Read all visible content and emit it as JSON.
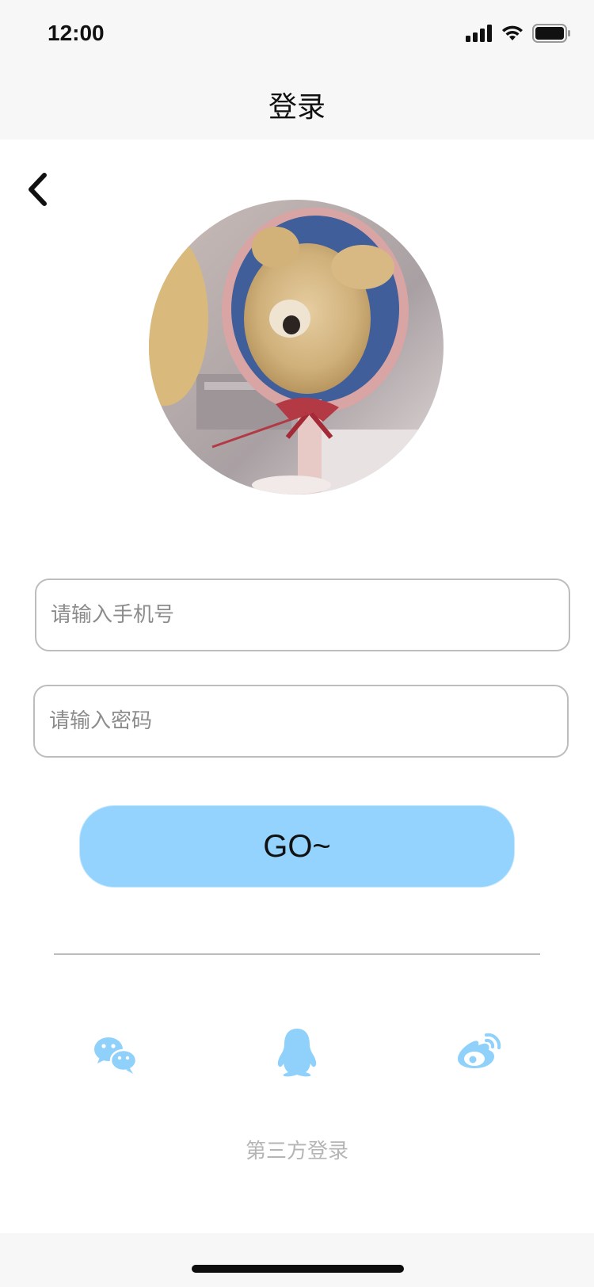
{
  "status_bar": {
    "time": "12:00"
  },
  "nav": {
    "title": "登录"
  },
  "login_form": {
    "phone_placeholder": "请输入手机号",
    "password_placeholder": "请输入密码",
    "submit_label": "GO~"
  },
  "third_party": {
    "label": "第三方登录",
    "providers": [
      "wechat-icon",
      "qq-icon",
      "weibo-icon"
    ]
  },
  "colors": {
    "accent": "#93d3fd",
    "social_icon": "#8fd1fb"
  }
}
